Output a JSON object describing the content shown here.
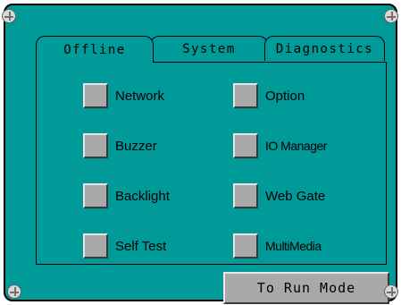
{
  "tabs": [
    {
      "label": "Offline",
      "active": true
    },
    {
      "label": "System",
      "active": false
    },
    {
      "label": "Diagnostics",
      "active": false
    }
  ],
  "options": {
    "left": [
      {
        "label": "Network"
      },
      {
        "label": "Buzzer"
      },
      {
        "label": "Backlight"
      },
      {
        "label": "Self Test"
      }
    ],
    "right": [
      {
        "label": "Option"
      },
      {
        "label": "IO Manager"
      },
      {
        "label": "Web Gate"
      },
      {
        "label": "MultiMedia"
      }
    ]
  },
  "run_button": {
    "label": "To Run Mode"
  },
  "colors": {
    "screen_bg": "#009a99",
    "button_face": "#a9a9a9"
  }
}
